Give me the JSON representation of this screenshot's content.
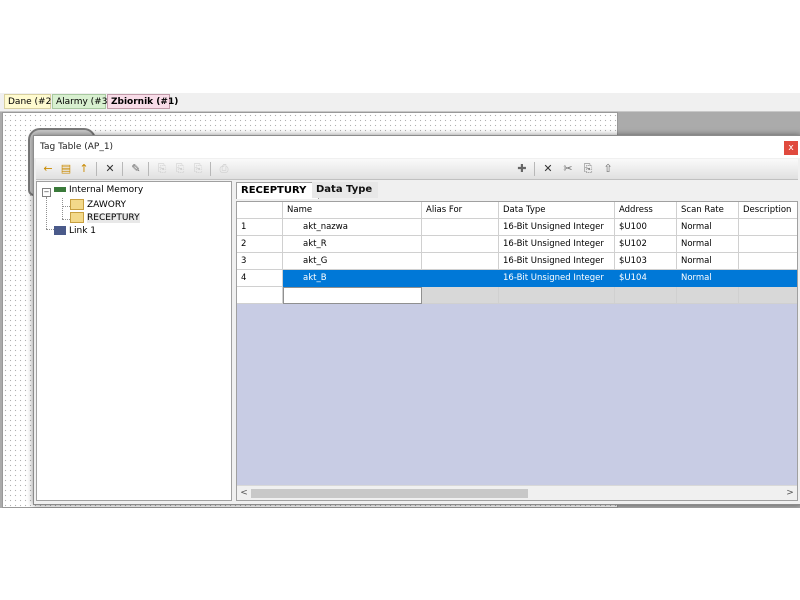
{
  "doc_tabs": [
    "Dane (#2)",
    "Alarmy (#3)",
    "Zbiornik (#1)"
  ],
  "dialog": {
    "title": "Tag Table (AP_1)",
    "close_glyph": "x"
  },
  "tree": {
    "root": "Internal Memory",
    "children": [
      "ZAWORY",
      "RECEPTURY"
    ],
    "link": "Link 1"
  },
  "subtabs": {
    "active": "RECEPTURY",
    "inactive": "Data Type"
  },
  "grid": {
    "columns": [
      "",
      "Name",
      "Alias For",
      "Data Type",
      "Address",
      "Scan Rate",
      "Description"
    ],
    "rows": [
      {
        "num": "1",
        "name": "akt_nazwa",
        "alias": "",
        "type": "16-Bit Unsigned Integer",
        "address": "$U100",
        "scan": "Normal",
        "desc": ""
      },
      {
        "num": "2",
        "name": "akt_R",
        "alias": "",
        "type": "16-Bit Unsigned Integer",
        "address": "$U102",
        "scan": "Normal",
        "desc": ""
      },
      {
        "num": "3",
        "name": "akt_G",
        "alias": "",
        "type": "16-Bit Unsigned Integer",
        "address": "$U103",
        "scan": "Normal",
        "desc": ""
      },
      {
        "num": "4",
        "name": "akt_B",
        "alias": "",
        "type": "16-Bit Unsigned Integer",
        "address": "$U104",
        "scan": "Normal",
        "desc": ""
      }
    ],
    "selected_row": 4
  },
  "scroll": {
    "left": "<",
    "right": ">"
  },
  "colors": {
    "selection": "#0078d7",
    "grid_empty": "#c8cce4",
    "close": "#e04a3e"
  }
}
